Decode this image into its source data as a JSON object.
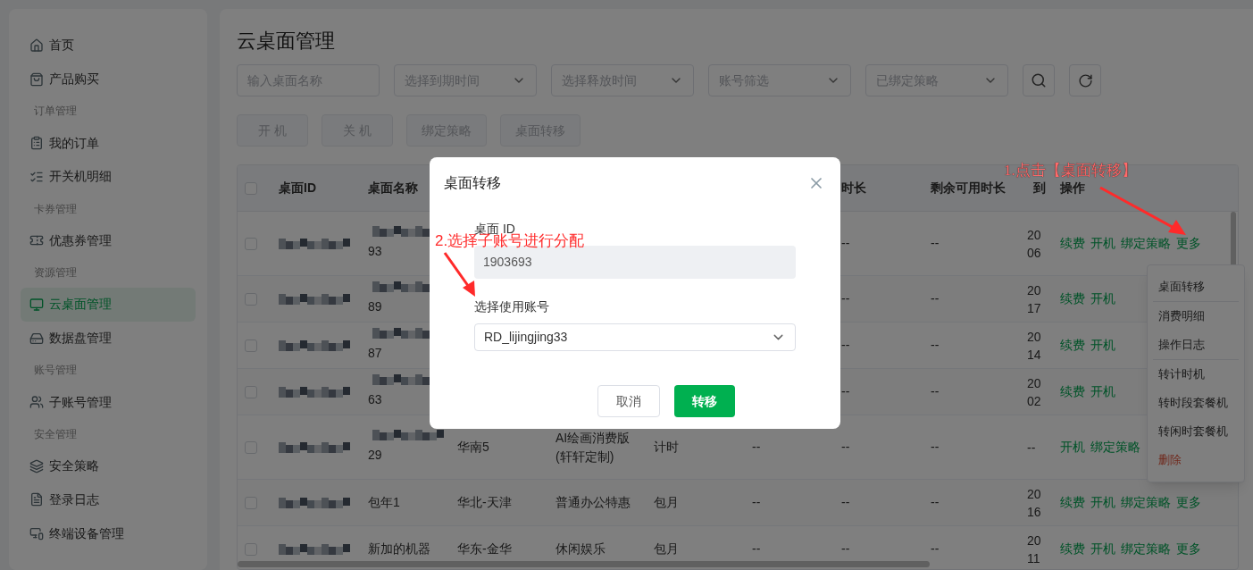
{
  "sidebar": {
    "items": [
      {
        "kind": "item",
        "label": "首页",
        "selected": false
      },
      {
        "kind": "item",
        "label": "产品购买",
        "selected": false
      },
      {
        "kind": "group",
        "label": "订单管理"
      },
      {
        "kind": "item",
        "label": "我的订单",
        "selected": false
      },
      {
        "kind": "item",
        "label": "开关机明细",
        "selected": false
      },
      {
        "kind": "group",
        "label": "卡券管理"
      },
      {
        "kind": "item",
        "label": "优惠券管理",
        "selected": false
      },
      {
        "kind": "group",
        "label": "资源管理"
      },
      {
        "kind": "item",
        "label": "云桌面管理",
        "selected": true
      },
      {
        "kind": "item",
        "label": "数据盘管理",
        "selected": false
      },
      {
        "kind": "group",
        "label": "账号管理"
      },
      {
        "kind": "item",
        "label": "子账号管理",
        "selected": false
      },
      {
        "kind": "group",
        "label": "安全管理"
      },
      {
        "kind": "item",
        "label": "安全策略",
        "selected": false
      },
      {
        "kind": "item",
        "label": "登录日志",
        "selected": false
      },
      {
        "kind": "item",
        "label": "终端设备管理",
        "selected": false
      }
    ]
  },
  "page_title": "云桌面管理",
  "filters": [
    {
      "kind": "input",
      "placeholder": "输入桌面名称"
    },
    {
      "kind": "select",
      "placeholder": "选择到期时间"
    },
    {
      "kind": "select",
      "placeholder": "选择释放时间"
    },
    {
      "kind": "select",
      "placeholder": "账号筛选"
    },
    {
      "kind": "select",
      "placeholder": "已绑定策略"
    }
  ],
  "actions": [
    {
      "label": "开 机",
      "disabled": true
    },
    {
      "label": "关 机",
      "disabled": true
    },
    {
      "label": "绑定策略",
      "disabled": true
    },
    {
      "label": "桌面转移",
      "disabled": true
    }
  ],
  "table": {
    "header_checked": false,
    "columns": [
      "桌面ID",
      "桌面名称",
      "时长",
      "剩余可用时长",
      "到",
      "操作"
    ],
    "rows": [
      {
        "checked": false,
        "id_blurred": true,
        "name_blurred": true,
        "name": "93",
        "duration": "--",
        "remaining": "--",
        "expiry": [
          "20",
          "06"
        ],
        "links": [
          "续费",
          "开机",
          "绑定策略",
          "更多"
        ]
      },
      {
        "checked": false,
        "id_blurred": true,
        "name_blurred": true,
        "name": "89",
        "duration": "--",
        "remaining": "--",
        "expiry": [
          "20",
          "17"
        ],
        "links": [
          "续费",
          "开机"
        ]
      },
      {
        "checked": false,
        "id_blurred": true,
        "name_blurred": true,
        "name": "87",
        "duration": "--",
        "remaining": "--",
        "expiry": [
          "20",
          "14"
        ],
        "links": [
          "续费",
          "开机"
        ]
      },
      {
        "checked": false,
        "id_blurred": true,
        "name_blurred": true,
        "name": "63",
        "duration": "--",
        "remaining": "--",
        "expiry": [
          "20",
          "02"
        ],
        "links": [
          "续费",
          "开机"
        ]
      },
      {
        "checked": false,
        "id_blurred": true,
        "name_blurred": true,
        "name": "29",
        "region": "华南5",
        "config": "AI绘画消费版(轩轩定制)",
        "billing": "计时",
        "column_6": "--",
        "duration": "--",
        "remaining": "--",
        "expiry": [
          "--"
        ],
        "links": [
          "开机",
          "绑定策略"
        ]
      },
      {
        "checked": false,
        "id_blurred": true,
        "name_blurred": false,
        "name": "包年1",
        "region": "华北-天津",
        "config": "普通办公特惠",
        "billing": "包月",
        "column_6": "--",
        "duration": "--",
        "remaining": "--",
        "expiry": [
          "20",
          "16"
        ],
        "links": [
          "续费",
          "开机",
          "绑定策略",
          "更多"
        ]
      },
      {
        "checked": false,
        "id_blurred": true,
        "name_blurred": false,
        "name": "新加的机器",
        "region": "华东-金华",
        "config": "休闲娱乐",
        "billing": "包月",
        "column_6": "--",
        "duration": "--",
        "remaining": "--",
        "expiry": [
          "20",
          "11"
        ],
        "links": [
          "续费",
          "开机",
          "绑定策略",
          "更多"
        ]
      }
    ]
  },
  "more_menu": {
    "items": [
      {
        "kind": "normal",
        "label": "桌面转移",
        "divider_after": true
      },
      {
        "kind": "normal",
        "label": "消费明细",
        "divider_after": false
      },
      {
        "kind": "normal",
        "label": "操作日志",
        "divider_after": true
      },
      {
        "kind": "normal",
        "label": "转计时机",
        "divider_after": false
      },
      {
        "kind": "normal",
        "label": "转时段套餐机",
        "divider_after": false
      },
      {
        "kind": "normal",
        "label": "转闲时套餐机",
        "divider_after": false
      },
      {
        "kind": "danger",
        "label": "删除",
        "divider_after": false
      }
    ]
  },
  "dialog": {
    "title": "桌面转移",
    "id_label": "桌面 ID",
    "id_value": "1903693",
    "account_label": "选择使用账号",
    "account_value": "RD_lijingjing33",
    "cancel": "取消",
    "confirm": "转移"
  },
  "annotations": [
    {
      "text": "1.点击【桌面转移】"
    },
    {
      "text": "2.选择子账号进行分配"
    }
  ]
}
